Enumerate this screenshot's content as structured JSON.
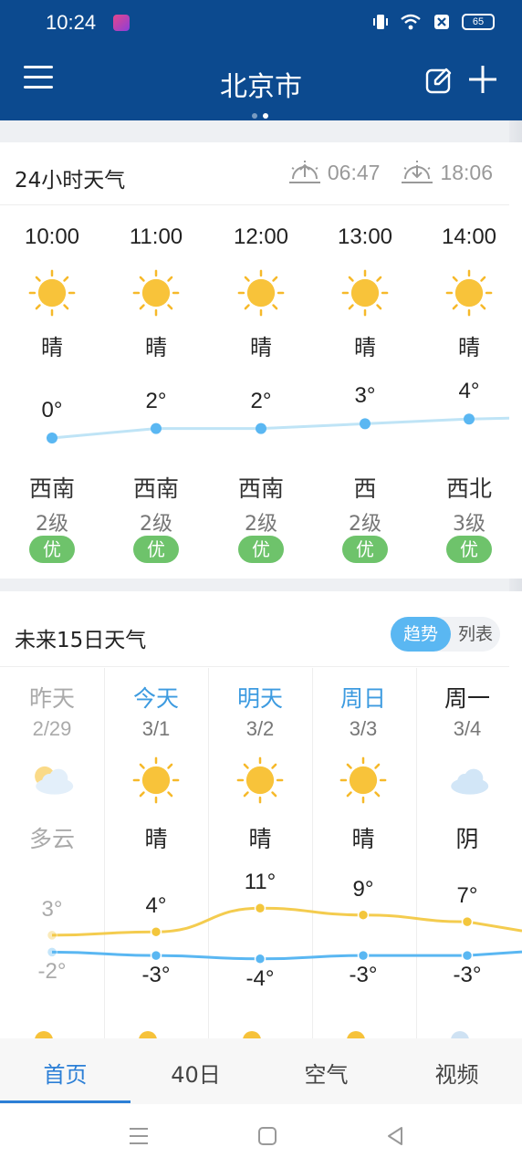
{
  "status_bar": {
    "time": "10:24",
    "battery": "65"
  },
  "header": {
    "city": "北京市"
  },
  "hourly": {
    "title": "24小时天气",
    "sunrise": "06:47",
    "sunset": "18:06",
    "items": [
      {
        "time": "10:00",
        "cond": "晴",
        "temp": "0°",
        "wind_dir": "西南",
        "wind_lvl": "2级",
        "aqi": "优"
      },
      {
        "time": "11:00",
        "cond": "晴",
        "temp": "2°",
        "wind_dir": "西南",
        "wind_lvl": "2级",
        "aqi": "优"
      },
      {
        "time": "12:00",
        "cond": "晴",
        "temp": "2°",
        "wind_dir": "西南",
        "wind_lvl": "2级",
        "aqi": "优"
      },
      {
        "time": "13:00",
        "cond": "晴",
        "temp": "3°",
        "wind_dir": "西",
        "wind_lvl": "2级",
        "aqi": "优"
      },
      {
        "time": "14:00",
        "cond": "晴",
        "temp": "4°",
        "wind_dir": "西北",
        "wind_lvl": "3级",
        "aqi": "优"
      }
    ]
  },
  "daily": {
    "title": "未来15日天气",
    "toggle_trend": "趋势",
    "toggle_list": "列表",
    "items": [
      {
        "day": "昨天",
        "date": "2/29",
        "cond": "多云",
        "high": "3°",
        "low": "-2°"
      },
      {
        "day": "今天",
        "date": "3/1",
        "cond": "晴",
        "high": "4°",
        "low": "-3°"
      },
      {
        "day": "明天",
        "date": "3/2",
        "cond": "晴",
        "high": "11°",
        "low": "-4°"
      },
      {
        "day": "周日",
        "date": "3/3",
        "cond": "晴",
        "high": "9°",
        "low": "-3°"
      },
      {
        "day": "周一",
        "date": "3/4",
        "cond": "阴",
        "high": "7°",
        "low": "-3°"
      }
    ]
  },
  "tabs": [
    "首页",
    "40日",
    "空气",
    "视频"
  ],
  "colors": {
    "header": "#0c4a8f",
    "accent": "#2c7fd6",
    "aqi_good": "#6ec36b",
    "high_line": "#f3c63c",
    "low_line": "#5ab7f2"
  }
}
